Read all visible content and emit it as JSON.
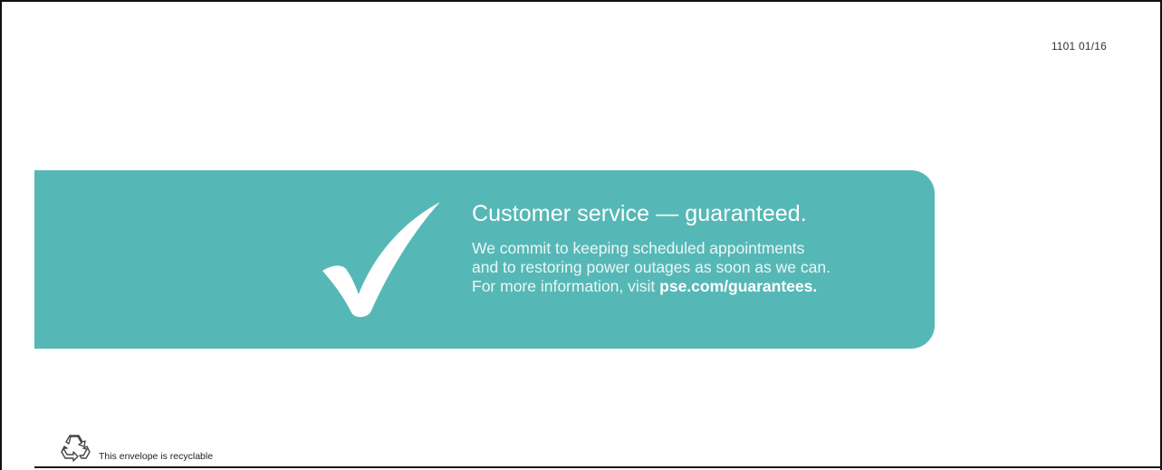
{
  "header": {
    "form_code": "1101 01/16"
  },
  "banner": {
    "background_color": "#56b8b6",
    "icon": "checkmark-icon",
    "headline": "Customer service — guaranteed.",
    "lines": [
      "We commit to keeping scheduled appointments",
      "and to restoring power outages as soon as we can."
    ],
    "more_info_prefix": "For more information, visit ",
    "more_info_link": "pse.com/guarantees."
  },
  "footer": {
    "icon": "recycle-icon",
    "recyclable_note": "This envelope is recyclable"
  }
}
